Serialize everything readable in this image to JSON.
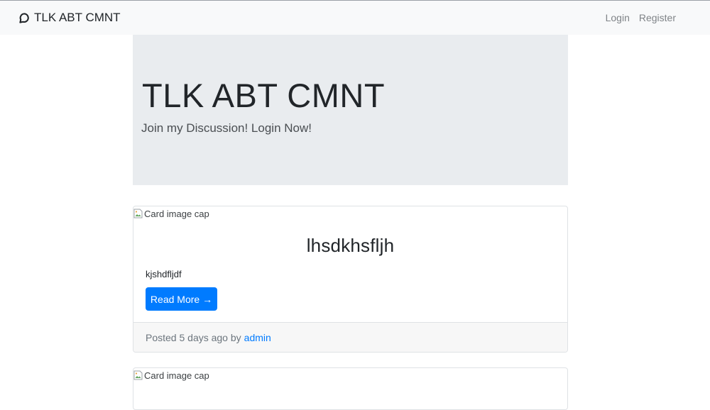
{
  "navbar": {
    "brand": "TLK ABT CMNT",
    "brand_icon": "chat-bubble-icon",
    "links": [
      "Login",
      "Register"
    ]
  },
  "jumbotron": {
    "title": "TLK ABT CMNT",
    "subtitle": "Join my Discussion! Login Now!"
  },
  "posts": [
    {
      "image_alt": "Card image cap",
      "title": "lhsdkhsfljh",
      "excerpt": "kjshdfljdf",
      "button_label": "Read More →",
      "footer_prefix": "Posted 5 days ago by",
      "author": "admin"
    },
    {
      "image_alt": "Card image cap"
    }
  ],
  "colors": {
    "primary": "#007bff",
    "navbar_bg": "#f8f9fa",
    "jumbotron_bg": "#e9ecef"
  }
}
